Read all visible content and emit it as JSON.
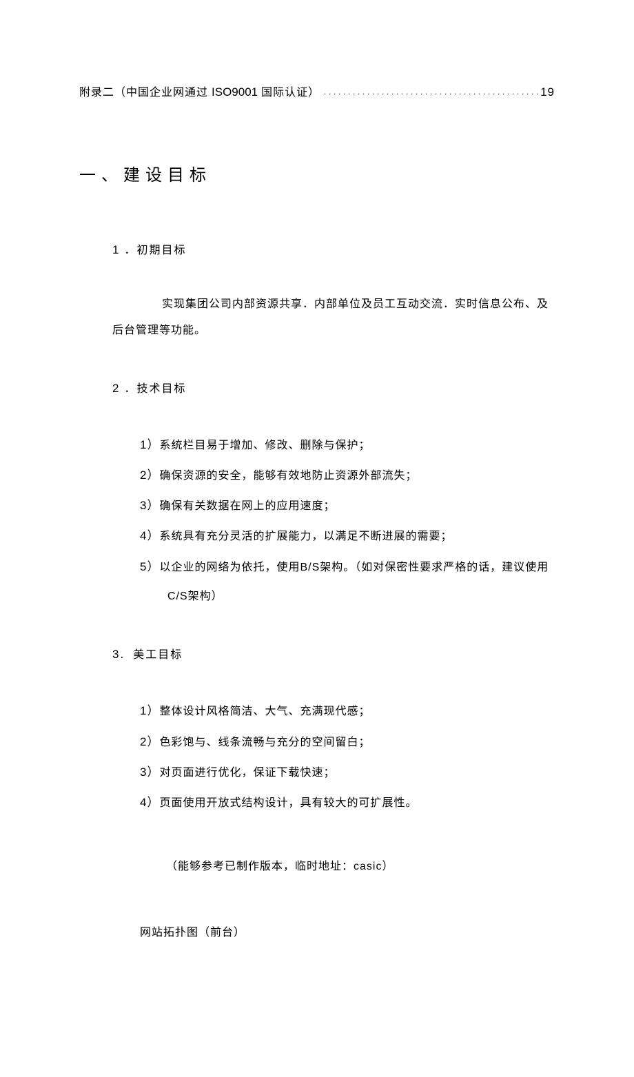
{
  "toc": {
    "prefix": "附录二（中国企业网通过 ",
    "iso": "ISO9001",
    "suffix": " 国际认证）",
    "page": "19"
  },
  "heading": "一、建设目标",
  "sec1": {
    "num": "1",
    "title": "．初期目标",
    "body": "实现集团公司内部资源共享．内部单位及员工互动交流．实时信息公布、及后台管理等功能。"
  },
  "sec2": {
    "num": "2",
    "title": "．技术目标",
    "items": [
      {
        "num": "1）",
        "text": "系统栏目易于增加、修改、删除与保护；"
      },
      {
        "num": "2）",
        "text": "确保资源的安全，能够有效地防止资源外部流失；"
      },
      {
        "num": "3）",
        "text": "确保有关数据在网上的应用速度；"
      },
      {
        "num": "4）",
        "text": "系统具有充分灵活的扩展能力，以满足不断进展的需要；"
      }
    ],
    "item5": {
      "num": "5）",
      "t1": "以企业的网络为依托，使用",
      "bs": "B/S",
      "t2": "架构。（如对保密性要求严格的话，建议使用",
      "cs": "C/S",
      "t3": "架构）"
    }
  },
  "sec3": {
    "num": "3.",
    "title": " 美工目标",
    "items": [
      {
        "num": "1）",
        "text": "整体设计风格简洁、大气、充满现代感；"
      },
      {
        "num": "2）",
        "text": "色彩饱与、线条流畅与充分的空间留白；"
      },
      {
        "num": "3）",
        "text": "对页面进行优化，保证下载快速；"
      },
      {
        "num": "4）",
        "text": "页面使用开放式结构设计，具有较大的可扩展性。"
      }
    ],
    "note_a": "（能够参考已制作版本，临时地址：",
    "note_b": "casic",
    "note_c": "）"
  },
  "standalone": "网站拓扑图（前台）"
}
